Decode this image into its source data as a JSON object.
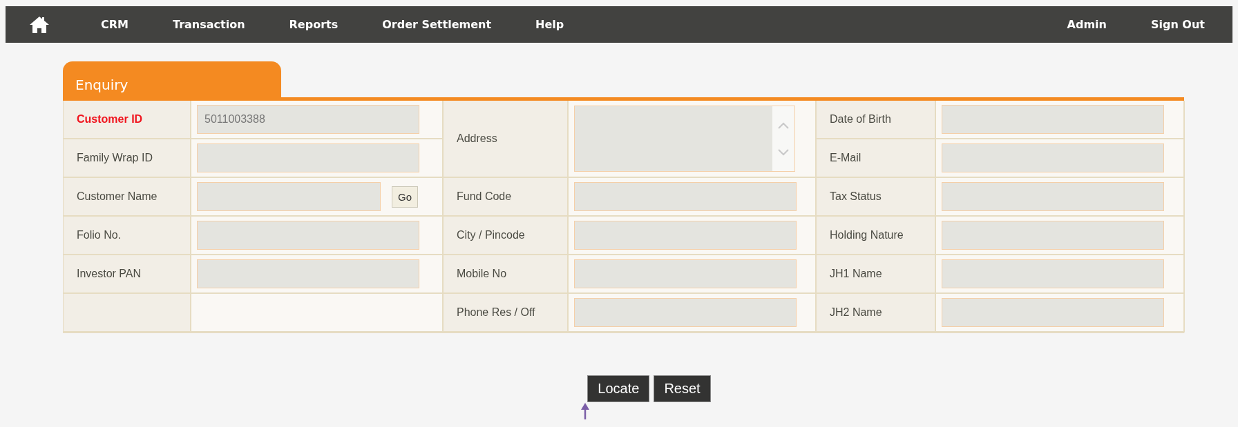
{
  "nav": {
    "items": [
      "CRM",
      "Transaction",
      "Reports",
      "Order Settlement",
      "Help"
    ],
    "right_items": [
      "Admin",
      "Sign Out"
    ]
  },
  "tabs": [
    {
      "label": "Enquiry",
      "selected": true
    }
  ],
  "form": {
    "columns": [
      [
        {
          "kind": "text",
          "label": "Customer ID",
          "required": true,
          "value": "5011003388"
        },
        {
          "kind": "text",
          "label": "Family Wrap ID",
          "required": false
        },
        {
          "kind": "text-go",
          "label": "Customer Name",
          "required": false,
          "button": "Go"
        },
        {
          "kind": "text",
          "label": "Folio No.",
          "required": false
        },
        {
          "kind": "text",
          "label": "Investor PAN",
          "required": false
        },
        {
          "kind": "empty"
        }
      ],
      [
        {
          "kind": "textarea",
          "label": "Address",
          "required": false
        },
        {
          "kind": "text",
          "label": "Fund Code",
          "required": false
        },
        {
          "kind": "text",
          "label": "City / Pincode",
          "required": false
        },
        {
          "kind": "text",
          "label": "Mobile No",
          "required": false
        },
        {
          "kind": "text",
          "label": "Phone Res / Off",
          "required": false
        }
      ],
      [
        {
          "kind": "text",
          "label": "Date of Birth",
          "required": false
        },
        {
          "kind": "text",
          "label": "E-Mail",
          "required": false
        },
        {
          "kind": "text",
          "label": "Tax Status",
          "required": false
        },
        {
          "kind": "text",
          "label": "Holding Nature",
          "required": false
        },
        {
          "kind": "text",
          "label": "JH1 Name",
          "required": false
        },
        {
          "kind": "text",
          "label": "JH2 Name",
          "required": false
        }
      ]
    ]
  },
  "buttons": [
    "Locate",
    "Reset"
  ]
}
